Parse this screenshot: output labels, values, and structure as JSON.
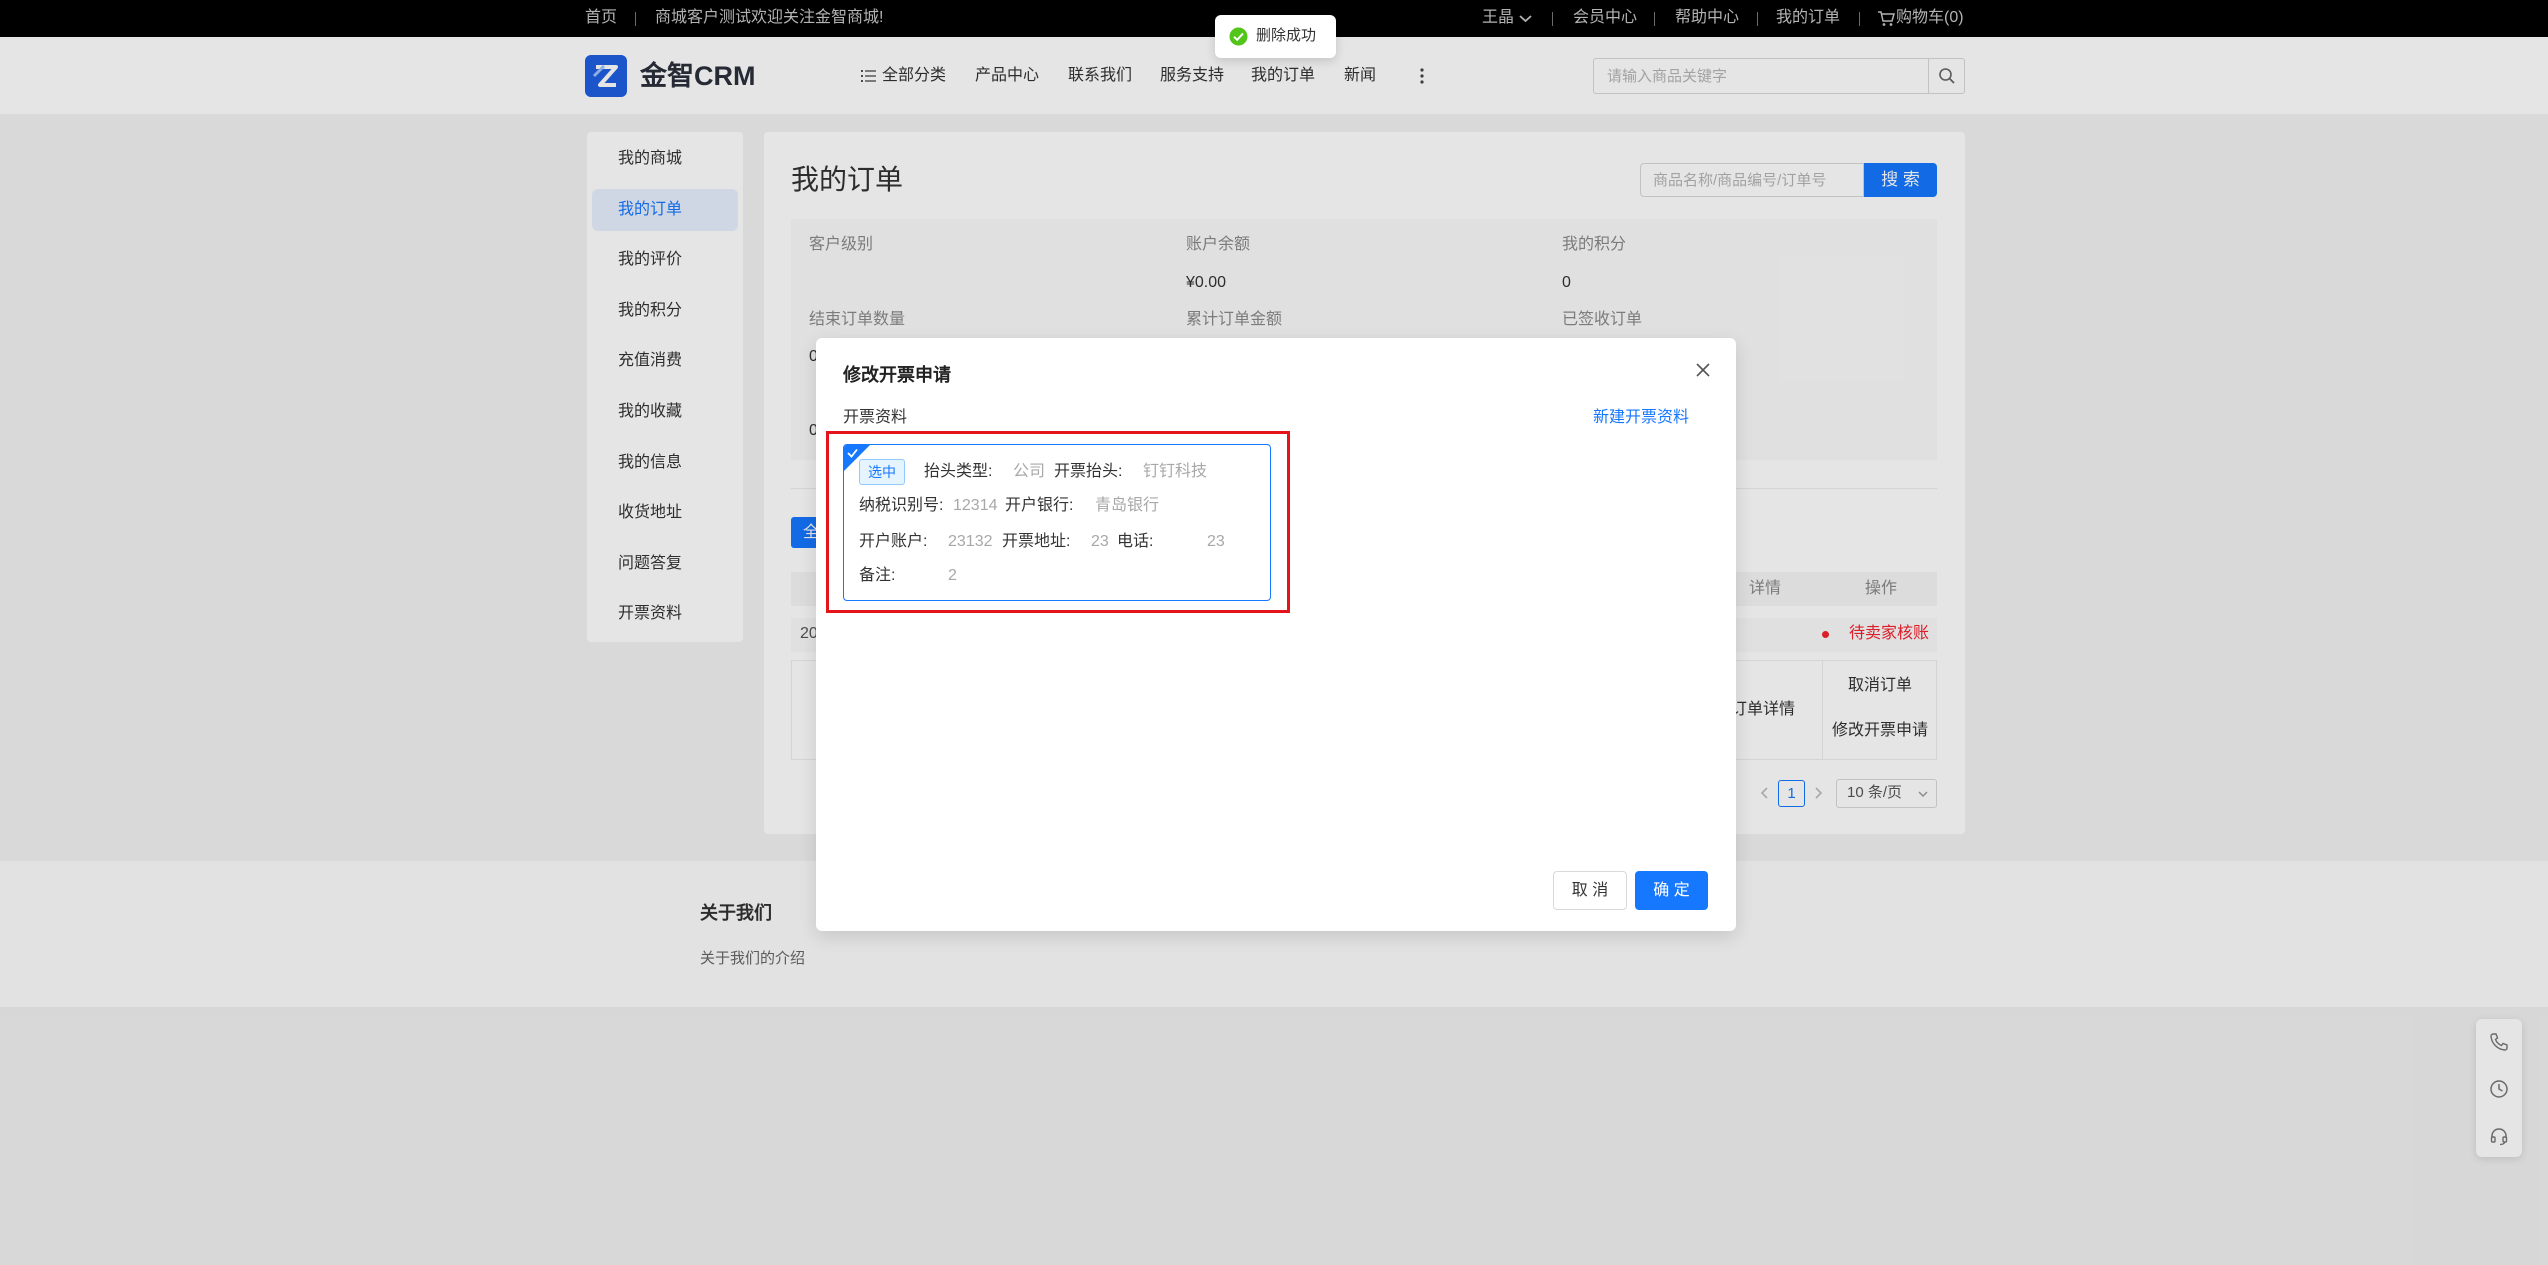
{
  "topbar": {
    "home": "首页",
    "welcome": "商城客户测试欢迎关注金智商城!",
    "user": "王晶",
    "links": [
      "会员中心",
      "帮助中心",
      "我的订单"
    ],
    "cart": "购物车(0)"
  },
  "toast": {
    "message": "删除成功"
  },
  "header": {
    "brand": "金智CRM",
    "nav": [
      "全部分类",
      "产品中心",
      "联系我们",
      "服务支持",
      "我的订单",
      "新闻"
    ],
    "search_placeholder": "请输入商品关键字"
  },
  "sidebar": {
    "items": [
      "我的商城",
      "我的订单",
      "我的评价",
      "我的积分",
      "充值消费",
      "我的收藏",
      "我的信息",
      "收货地址",
      "问题答复",
      "开票资料"
    ],
    "active": "我的订单"
  },
  "main": {
    "title": "我的订单",
    "search_placeholder": "商品名称/商品编号/订单号",
    "search_button": "搜 索",
    "stats": {
      "row1": [
        {
          "label": "客户级别"
        },
        {
          "label": "账户余额",
          "value": "¥0.00"
        },
        {
          "label": "我的积分",
          "value": "0"
        }
      ],
      "row2": [
        {
          "label": "结束订单数量",
          "value": "0"
        },
        {
          "label": "累计订单金额"
        },
        {
          "label": "已签收订单"
        }
      ],
      "row3": [
        {
          "value": "0"
        }
      ]
    },
    "tab_button": "全",
    "table": {
      "headers": [
        "详情",
        "操作"
      ],
      "order_no": "20",
      "status": "待卖家核账",
      "detail_link": "订单详情",
      "actions": [
        "取消订单",
        "修改开票申请"
      ]
    },
    "pagination": {
      "current": "1",
      "page_size": "10 条/页"
    }
  },
  "footer": {
    "title": "关于我们",
    "text": "关于我们的介绍"
  },
  "modal": {
    "title": "修改开票申请",
    "section_label": "开票资料",
    "new_link": "新建开票资料",
    "card": {
      "tag": "选中",
      "fields": [
        {
          "label": "抬头类型:",
          "value": "公司"
        },
        {
          "label": "开票抬头:",
          "value": "钉钉科技"
        },
        {
          "label": "纳税识别号:",
          "value": "12314"
        },
        {
          "label": "开户银行:",
          "value": "青岛银行"
        },
        {
          "label": "开户账户:",
          "value": "23132"
        },
        {
          "label": "开票地址:",
          "value": "23"
        },
        {
          "label": "电话:",
          "value": "23"
        },
        {
          "label": "备注:",
          "value": "2"
        }
      ]
    },
    "cancel": "取 消",
    "ok": "确 定"
  },
  "colors": {
    "primary": "#1677ff",
    "highlight_box": "#e5141b",
    "status_danger": "#f5222d",
    "toast_success": "#52c41a",
    "topbar_bg": "#000000"
  },
  "icons": [
    "brand-logo-icon",
    "chevron-down-icon",
    "cart-icon",
    "list-icon",
    "more-vertical-icon",
    "search-icon",
    "success-check-icon",
    "close-icon",
    "selected-corner-check-icon",
    "chevron-left-icon",
    "chevron-right-icon",
    "phone-icon",
    "clock-icon",
    "headset-icon"
  ]
}
